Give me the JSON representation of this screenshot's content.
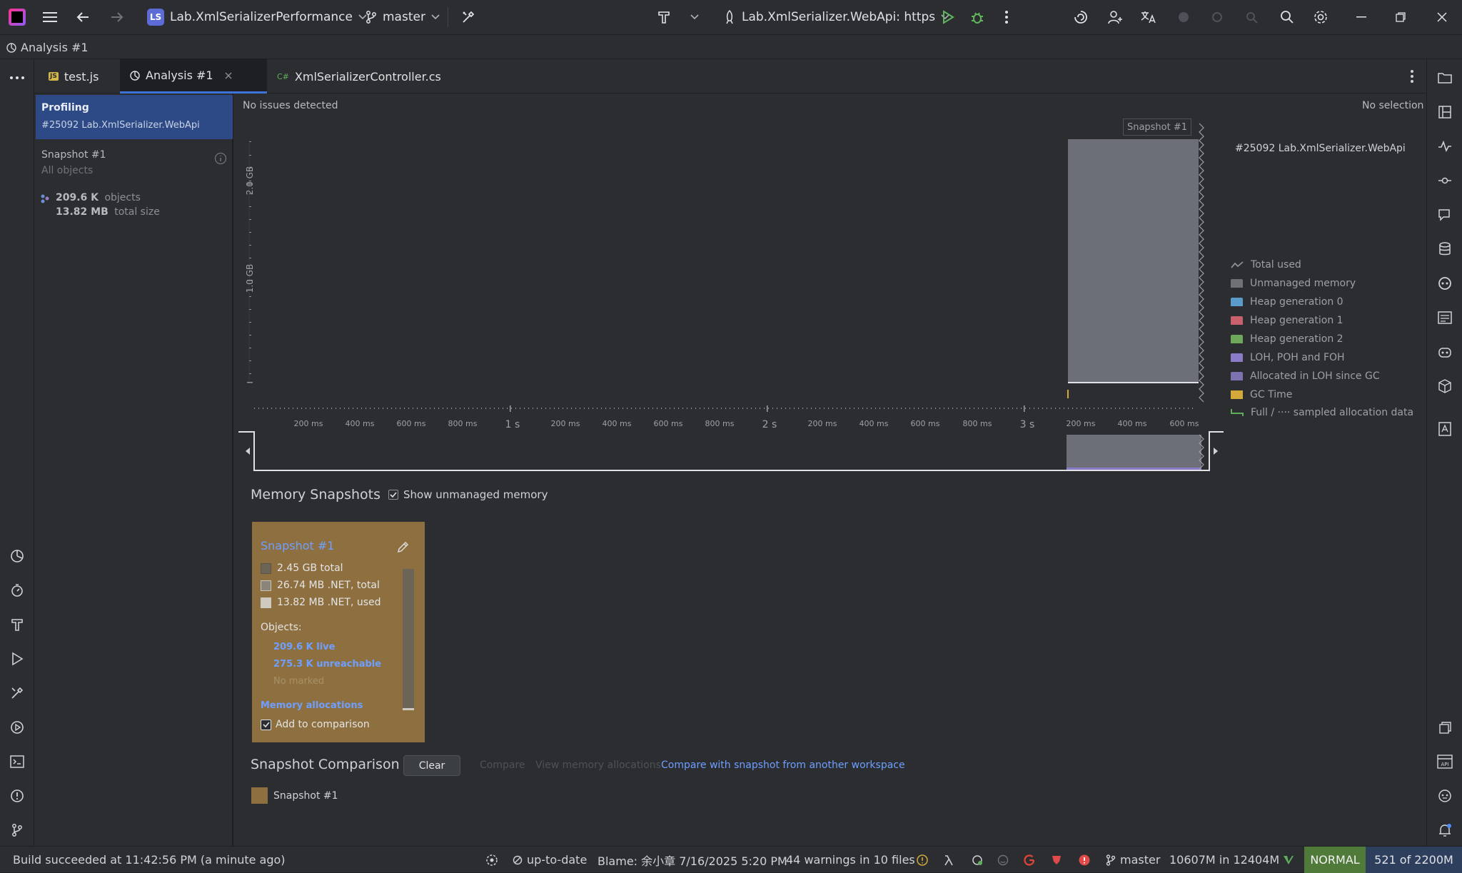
{
  "topbar": {
    "project_badge": "LS",
    "project_name": "Lab.XmlSerializerPerformance",
    "branch": "master",
    "run_config": "Lab.XmlSerializer.WebApi: https"
  },
  "breadcrumb": {
    "label": "Analysis #1"
  },
  "tabs": [
    {
      "label": "test.js",
      "badge": "JS"
    },
    {
      "label": "Analysis #1"
    },
    {
      "label": "XmlSerializerController.cs",
      "badge": "C#"
    }
  ],
  "sidepanel": {
    "profiling_title": "Profiling",
    "profiling_subtitle": "#25092 Lab.XmlSerializer.WebApi",
    "snapshot_title": "Snapshot #1",
    "snapshot_subtitle": "All objects",
    "objects_count": "209.6 K",
    "objects_label": "objects",
    "size_value": "13.82 MB",
    "size_label": "total size"
  },
  "analysis": {
    "issues": "No issues detected",
    "selection": "No selection",
    "process_label": "#25092 Lab.XmlSerializer.WebApi",
    "snapshot_marker": "Snapshot #1",
    "y_labels": [
      "2.0 GB",
      "1.0 GB"
    ],
    "ms_ticks": [
      "200 ms",
      "400 ms",
      "600 ms",
      "800 ms",
      "200 ms",
      "400 ms",
      "600 ms",
      "800 ms",
      "200 ms",
      "400 ms",
      "600 ms",
      "800 ms",
      "200 ms",
      "400 ms",
      "600 ms"
    ],
    "sec_ticks": [
      "1 s",
      "2 s",
      "3 s"
    ]
  },
  "legend": [
    {
      "label": "Total used",
      "color": "#8c8f94"
    },
    {
      "label": "Unmanaged memory",
      "color": "#6f7177"
    },
    {
      "label": "Heap generation 0",
      "color": "#5a9bc9"
    },
    {
      "label": "Heap generation 1",
      "color": "#c9606b"
    },
    {
      "label": "Heap generation 2",
      "color": "#6fa85a"
    },
    {
      "label": "LOH, POH and FOH",
      "color": "#8a7bc9"
    },
    {
      "label": "Allocated in LOH since GC",
      "color": "#7f72b0"
    },
    {
      "label": "GC Time",
      "color": "#d4a93a"
    },
    {
      "label": "Full / ···· sampled allocation data",
      "color": "#5fae5c"
    }
  ],
  "memory_snapshots": {
    "title": "Memory Snapshots",
    "show_unmanaged_label": "Show unmanaged memory",
    "show_unmanaged_checked": true,
    "card": {
      "title": "Snapshot #1",
      "total": "2.45 GB total",
      "net_total": "26.74 MB .NET, total",
      "net_used": "13.82 MB .NET, used",
      "objects_label": "Objects:",
      "live": "209.6 K live",
      "unreachable": "275.3 K unreachable",
      "marked": "No marked",
      "allocations_link": "Memory allocations",
      "add_to_comparison": "Add to comparison",
      "add_checked": true
    }
  },
  "comparison": {
    "title": "Snapshot Comparison",
    "clear": "Clear",
    "compare": "Compare",
    "view_allocations": "View memory allocations",
    "compare_other": "Compare with snapshot from another workspace",
    "item": "Snapshot #1"
  },
  "statusbar": {
    "build": "Build succeeded at 11:42:56 PM (a minute ago)",
    "uptodate": "up-to-date",
    "blame": "Blame: 余小章 7/16/2025 5:20 PM",
    "warnings": "44 warnings in 10 files",
    "branch": "master",
    "memory": "10607M in 12404M",
    "mode": "NORMAL",
    "position": "521 of 2200M"
  }
}
